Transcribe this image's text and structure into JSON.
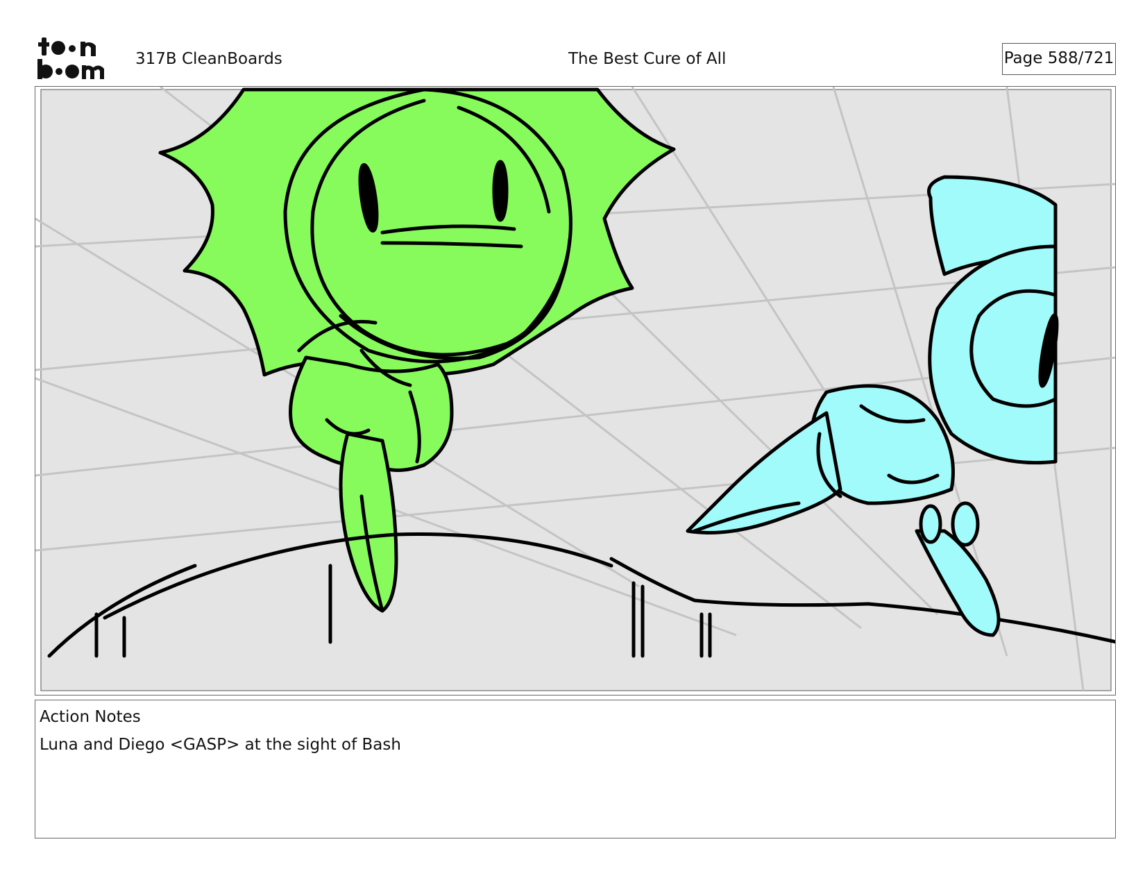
{
  "header": {
    "logo_line1": "toon",
    "logo_line2": "boom",
    "episode": "317B  CleanBoards",
    "title": "The Best Cure of All",
    "page": "Page 588/721"
  },
  "panel": {
    "background_color": "#e4e4e4",
    "grid_color": "#c4c4c4",
    "character_left_color": "#88fb5c",
    "character_right_color": "#a1fbfb",
    "line_color": "#000000"
  },
  "notes": {
    "label": "Action Notes",
    "text": "Luna and Diego <GASP> at the sight of Bash"
  }
}
